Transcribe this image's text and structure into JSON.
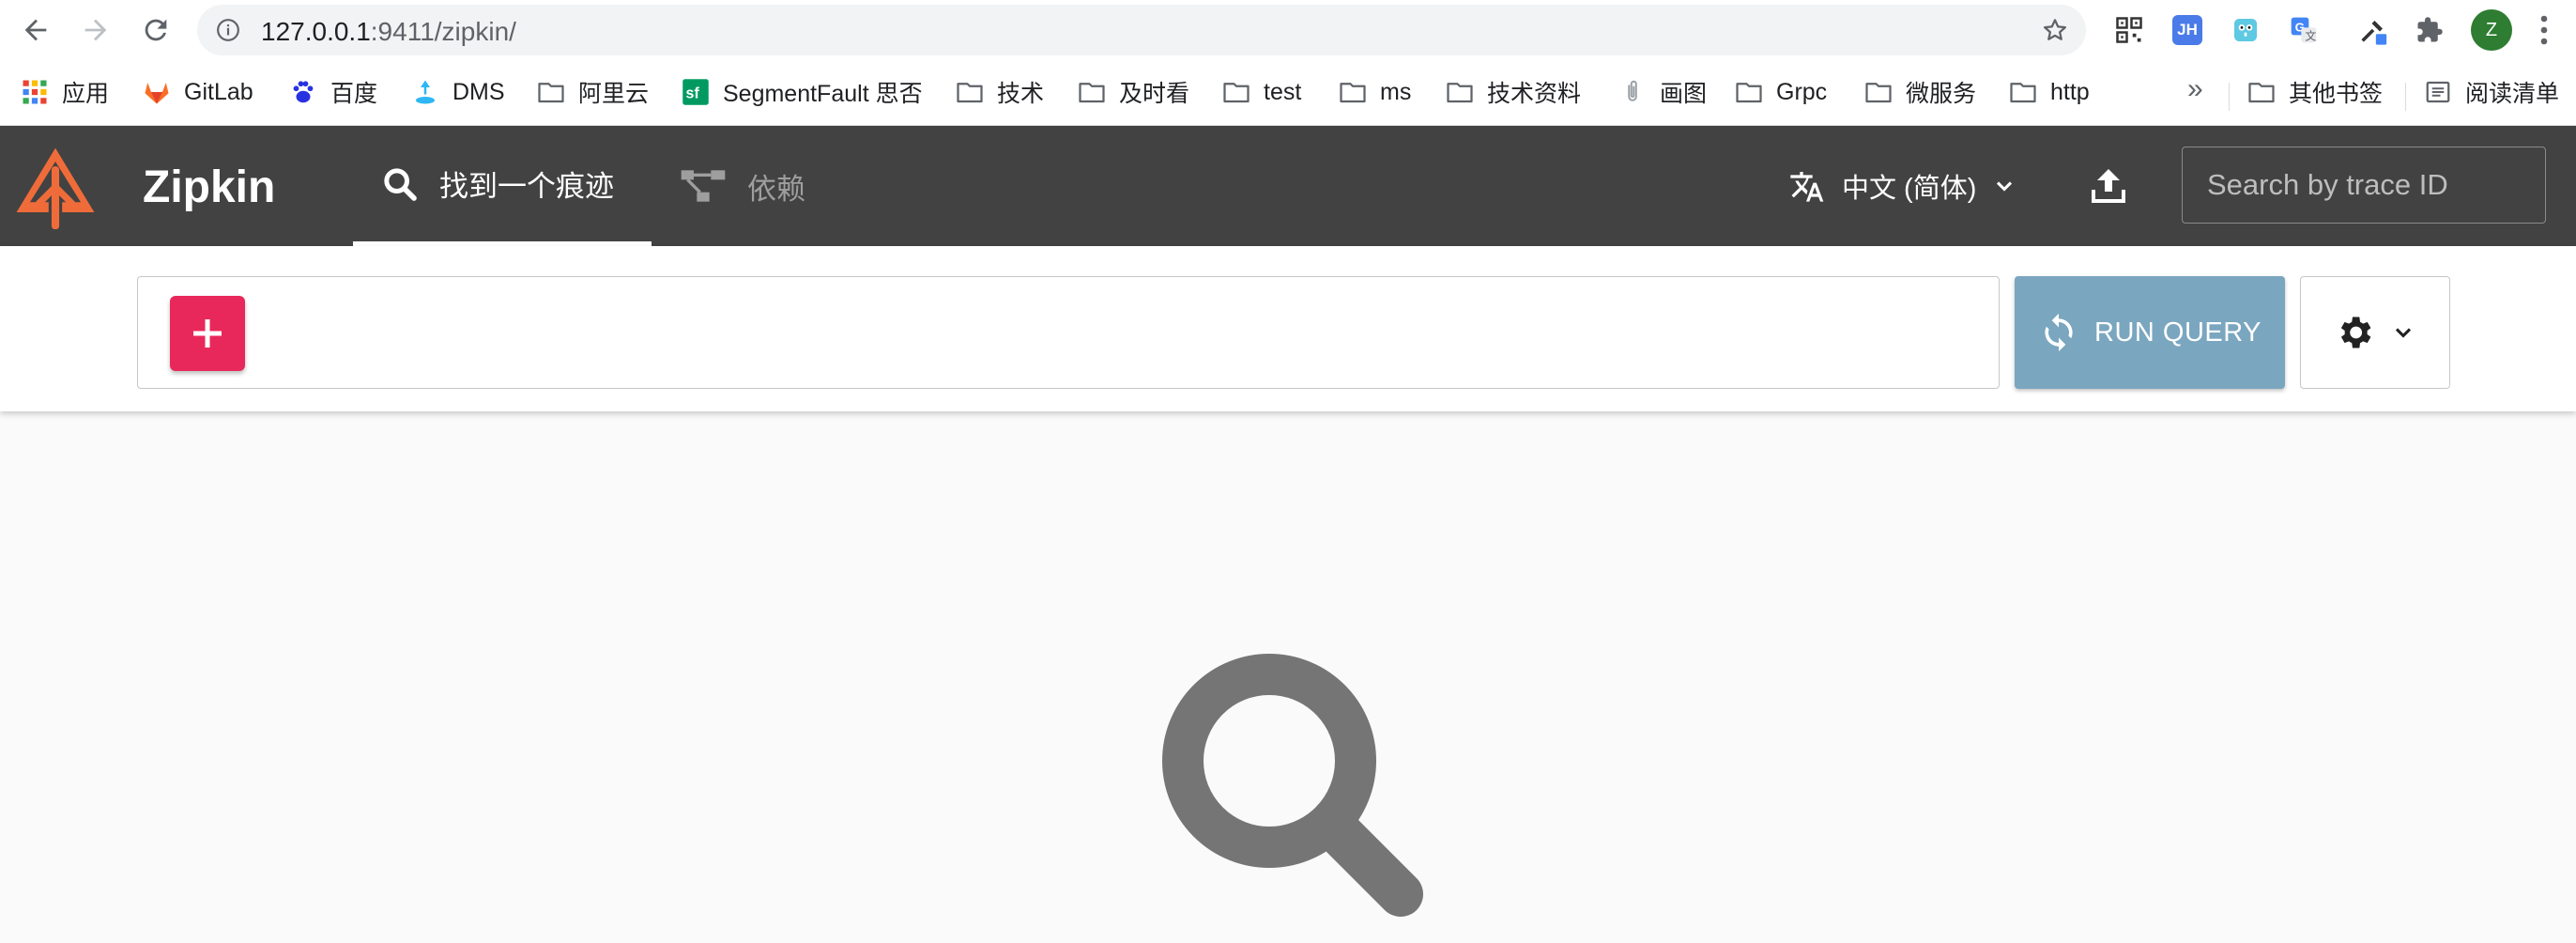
{
  "browser": {
    "url_host": "127.0.0.1",
    "url_rest": ":9411/zipkin/",
    "extensions": [
      {
        "name": "qr-code-extension-icon",
        "label": ""
      },
      {
        "name": "jh-extension-icon",
        "label": "JH"
      },
      {
        "name": "gopher-extension-icon",
        "label": ""
      },
      {
        "name": "translate-extension-icon",
        "label": ""
      },
      {
        "name": "eyedropper-extension-icon",
        "label": ""
      },
      {
        "name": "puzzle-extensions-icon",
        "label": ""
      }
    ],
    "profile_initial": "Z"
  },
  "bookmarks": {
    "items": [
      {
        "label": "应用",
        "icon": "apps-grid-icon"
      },
      {
        "label": "GitLab",
        "icon": "gitlab-icon"
      },
      {
        "label": "百度",
        "icon": "baidu-paw-icon"
      },
      {
        "label": "DMS",
        "icon": "dms-icon"
      },
      {
        "label": "阿里云",
        "icon": "folder-icon"
      },
      {
        "label": "SegmentFault 思否",
        "icon": "segmentfault-icon"
      },
      {
        "label": "技术",
        "icon": "folder-icon"
      },
      {
        "label": "及时看",
        "icon": "folder-icon"
      },
      {
        "label": "test",
        "icon": "folder-icon"
      },
      {
        "label": "ms",
        "icon": "folder-icon"
      },
      {
        "label": "技术资料",
        "icon": "folder-icon"
      },
      {
        "label": "画图",
        "icon": "paperclip-icon"
      },
      {
        "label": "Grpc",
        "icon": "folder-icon"
      },
      {
        "label": "微服务",
        "icon": "folder-icon"
      },
      {
        "label": "http",
        "icon": "folder-icon"
      }
    ],
    "overflow": "»",
    "other_bookmarks": "其他书签",
    "reading_list": "阅读清单"
  },
  "header": {
    "title": "Zipkin",
    "tabs": [
      {
        "label": "找到一个痕迹",
        "active": true
      },
      {
        "label": "依赖",
        "active": false
      }
    ],
    "language": "中文 (简体)",
    "trace_search_placeholder": "Search by trace ID"
  },
  "query": {
    "run_label": "RUN QUERY"
  },
  "colors": {
    "header_bg": "#424242",
    "logo_orange": "#ef6c3a",
    "add_button": "#e8285a",
    "run_button": "#7ba6bf",
    "empty_icon": "#757575"
  }
}
